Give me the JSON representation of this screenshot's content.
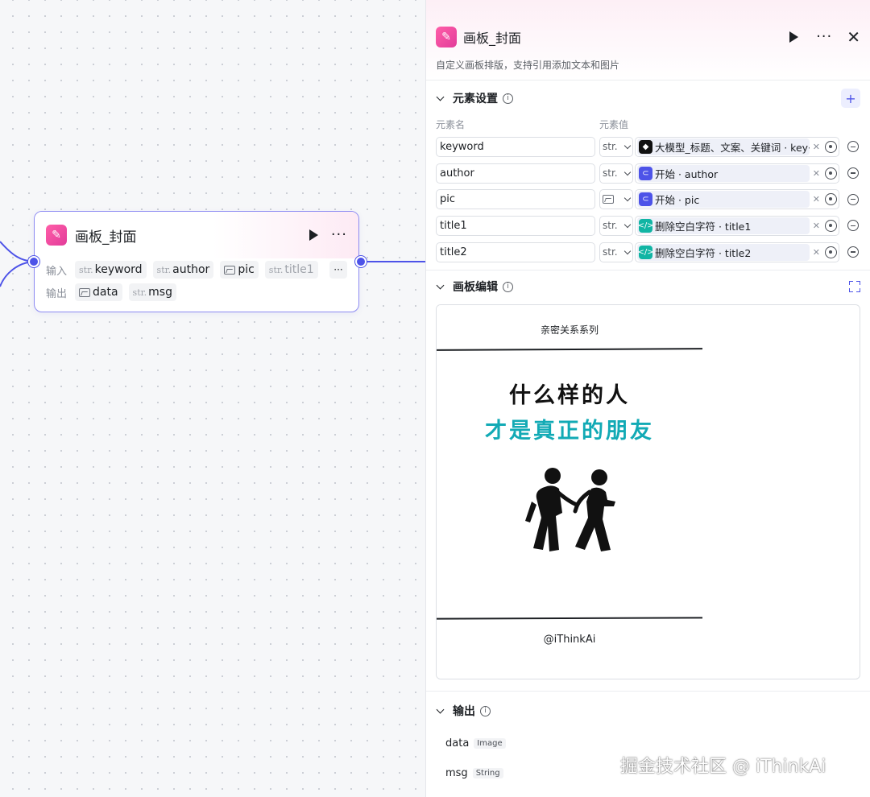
{
  "node": {
    "title": "画板_封面",
    "input_label": "输入",
    "output_label": "输出",
    "inputs": [
      {
        "type": "str.",
        "name": "keyword"
      },
      {
        "type": "str.",
        "name": "author"
      },
      {
        "type": "image",
        "name": "pic"
      },
      {
        "type": "str.",
        "name": "title1"
      }
    ],
    "outputs": [
      {
        "type": "image",
        "name": "data"
      },
      {
        "type": "str.",
        "name": "msg"
      }
    ],
    "more_label": "···"
  },
  "panel": {
    "title": "画板_封面",
    "description": "自定义画板排版，支持引用添加文本和图片",
    "elements_section": {
      "title": "元素设置",
      "col_name": "元素名",
      "col_value": "元素值",
      "rows": [
        {
          "name": "keyword",
          "type": "str.",
          "source_icon": "llm-icon",
          "ref": "大模型_标题、文案、关键词 · key···"
        },
        {
          "name": "author",
          "type": "str.",
          "source_icon": "start-icon",
          "ref": "开始 · author"
        },
        {
          "name": "pic",
          "type": "image",
          "source_icon": "start-icon",
          "ref": "开始 · pic"
        },
        {
          "name": "title1",
          "type": "str.",
          "source_icon": "code-icon",
          "ref": "删除空白字符 · title1"
        },
        {
          "name": "title2",
          "type": "str.",
          "source_icon": "code-icon",
          "ref": "删除空白字符 · title2"
        }
      ]
    },
    "board_section": {
      "title": "画板编辑",
      "board": {
        "top_text": "亲密关系系列",
        "title1": "什么样的人",
        "title2": "才是真正的朋友",
        "author": "@iThinkAi",
        "title2_color": "#12aab5"
      }
    },
    "output_section": {
      "title": "输出",
      "items": [
        {
          "name": "data",
          "type": "Image"
        },
        {
          "name": "msg",
          "type": "String"
        }
      ]
    }
  },
  "watermark": "掘金技术社区 @ iThinkAi",
  "colors": {
    "accent": "#4d53e8",
    "node_border": "#8d8bf2",
    "app_icon": "#e23c9a"
  }
}
